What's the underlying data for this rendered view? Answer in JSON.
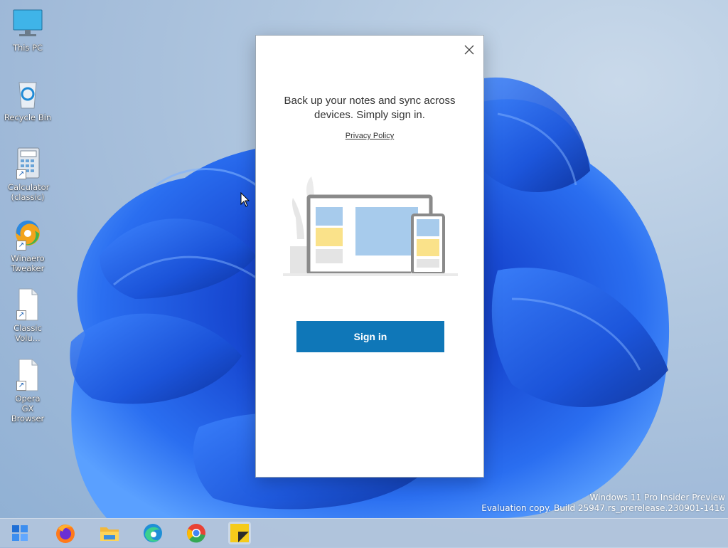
{
  "desktop": {
    "icons": [
      {
        "label": "This PC",
        "icon": "monitor-icon"
      },
      {
        "label": "Recycle Bin",
        "icon": "recycle-bin-icon"
      },
      {
        "label": "Calculator (classic)",
        "icon": "calculator-icon"
      },
      {
        "label": "Winaero Tweaker",
        "icon": "winaero-tweaker-icon"
      },
      {
        "label": "Classic Volu...",
        "icon": "file-icon"
      },
      {
        "label": "Opera GX Browser",
        "icon": "file-icon"
      }
    ]
  },
  "dialog": {
    "heading_line1": "Back up your notes and sync across",
    "heading_line2": "devices. Simply sign in.",
    "privacy_link": "Privacy Policy",
    "signin_label": "Sign in",
    "close_icon": "close-icon",
    "illustration": "devices-sync-illustration"
  },
  "watermark": {
    "line1": "Windows 11 Pro Insider Preview",
    "line2": "Evaluation copy. Build 25947.rs_prerelease.230901-1416"
  },
  "taskbar": {
    "items": [
      "start-icon",
      "firefox-icon",
      "file-explorer-icon",
      "edge-icon",
      "chrome-icon",
      "sticky-notes-icon"
    ],
    "active": "sticky-notes-icon"
  },
  "colors": {
    "signin_button": "#0f77b8",
    "bloom_blue": "#1d5ee0"
  }
}
